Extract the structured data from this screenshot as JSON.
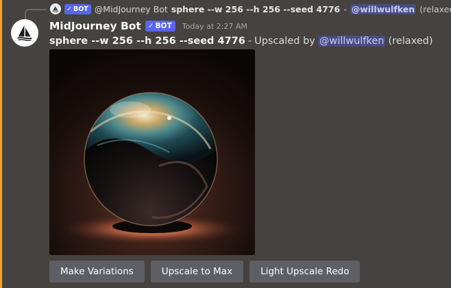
{
  "colors": {
    "background": "#45423f",
    "accent_bar": "#f0a232",
    "bot_tag": "#5865f2",
    "mention_bg": "#4a4d7f",
    "button_bg": "#5d5f65"
  },
  "reply": {
    "bot_tag": "BOT",
    "author": "@MidJourney Bot",
    "command": "sphere --w 256 --h 256 --seed 4776",
    "dash": "-",
    "mention": "@willwulfken",
    "mode": "(relaxed)",
    "icon": "image-icon"
  },
  "message": {
    "avatar_icon": "sailboat-logo-icon",
    "username": "MidJourney Bot",
    "bot_tag": "BOT",
    "timestamp": "Today at 2:27 AM",
    "prompt": "sphere --w 256 --h 256 --seed 4776",
    "separator": "-",
    "upscaled_by": "Upscaled by",
    "mention": "@willwulfken",
    "mode": "(relaxed)"
  },
  "attachment": {
    "kind": "image"
  },
  "buttons": [
    {
      "label": "Make Variations"
    },
    {
      "label": "Upscale to Max"
    },
    {
      "label": "Light Upscale Redo"
    }
  ]
}
